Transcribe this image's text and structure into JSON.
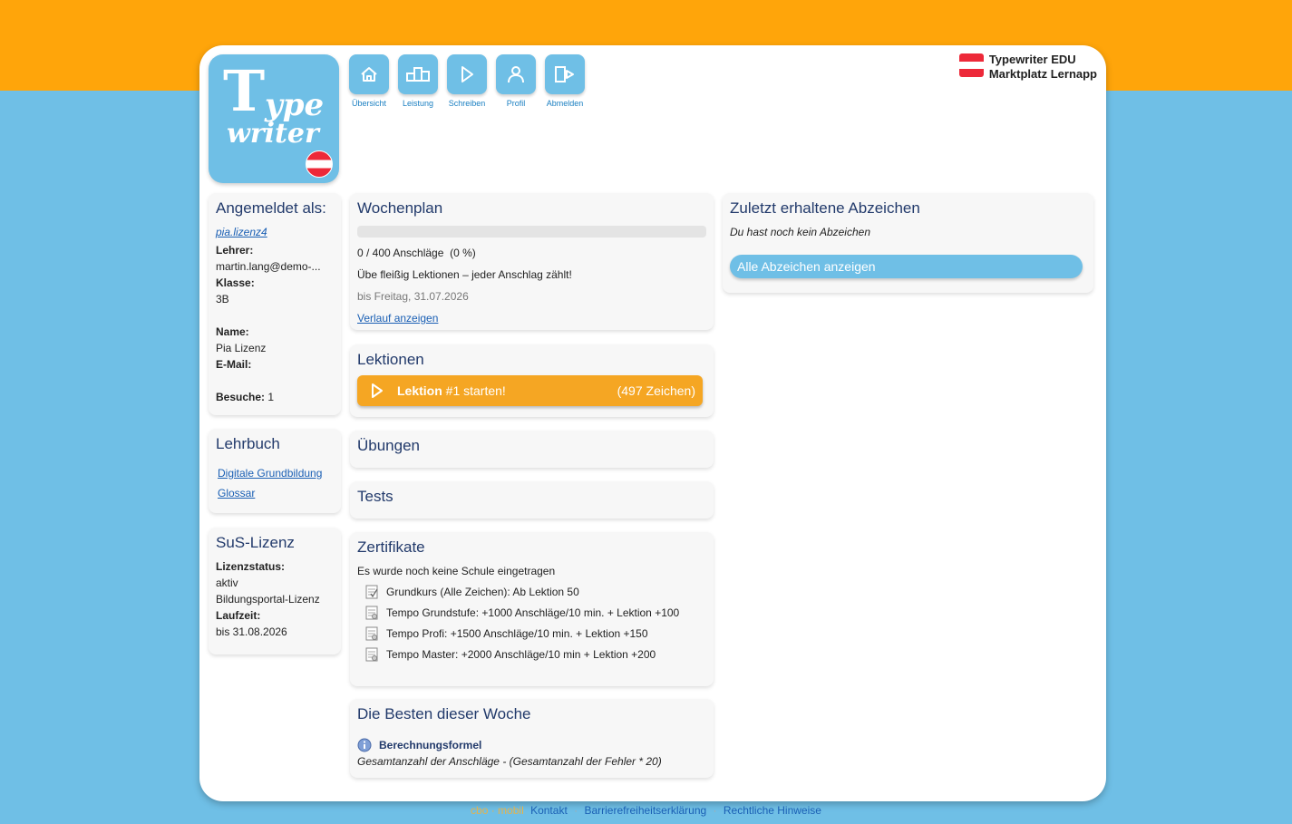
{
  "logo": {
    "word1": "T",
    "word1b": "ype",
    "word2": "writer"
  },
  "nav": [
    {
      "label": "Übersicht",
      "icon": "home-icon"
    },
    {
      "label": "Leistung",
      "icon": "podium-icon"
    },
    {
      "label": "Schreiben",
      "icon": "play-icon"
    },
    {
      "label": "Profil",
      "icon": "user-icon"
    },
    {
      "label": "Abmelden",
      "icon": "logout-icon"
    }
  ],
  "brand": {
    "line1": "Typewriter EDU",
    "line2": "Marktplatz Lernapp"
  },
  "account": {
    "title": "Angemeldet als:",
    "username": "pia.lizenz4",
    "teacher_label": "Lehrer:",
    "teacher": "martin.lang@demo-...",
    "class_label": "Klasse:",
    "class": "3B",
    "name_label": "Name:",
    "name": "Pia Lizenz",
    "email_label": "E-Mail:",
    "visits_label": "Besuche:",
    "visits": "1"
  },
  "textbook": {
    "title": "Lehrbuch",
    "links": [
      "Digitale Grundbildung",
      "Glossar"
    ]
  },
  "license": {
    "title": "SuS-Lizenz",
    "status_label": "Lizenzstatus:",
    "status": "aktiv",
    "type": "Bildungsportal-Lizenz",
    "runtime_label": "Laufzeit:",
    "runtime": "bis 31.08.2026"
  },
  "weekplan": {
    "title": "Wochenplan",
    "progress": 0,
    "progress_text": "0 / 400 Anschläge  (0 %)",
    "motto": "Übe fleißig Lektionen – jeder Anschlag zählt!",
    "deadline": "bis Freitag, 31.07.2026",
    "history_link": "Verlauf anzeigen"
  },
  "lessons": {
    "title": "Lektionen",
    "start_bold": "Lektion",
    "start_rest": " #1 starten!",
    "count": "(497 Zeichen)"
  },
  "exercises": {
    "title": "Übungen"
  },
  "tests": {
    "title": "Tests"
  },
  "certificates": {
    "title": "Zertifikate",
    "note": "Es wurde noch keine Schule eingetragen",
    "items": [
      "Grundkurs (Alle Zeichen): Ab Lektion 50",
      "Tempo Grundstufe: +1000 Anschläge/10 min. + Lektion +100",
      "Tempo Profi: +1500 Anschläge/10 min. + Lektion +150",
      "Tempo Master: +2000 Anschläge/10 min + Lektion +200"
    ]
  },
  "best": {
    "title": "Die Besten dieser Woche",
    "formula_label": "Berechnungsformel",
    "formula": "Gesamtanzahl der Anschläge - (Gesamtanzahl der Fehler * 20)"
  },
  "badges": {
    "title": "Zuletzt erhaltene Abzeichen",
    "empty": "Du hast noch kein Abzeichen",
    "button": "Alle Abzeichen anzeigen"
  },
  "footer": {
    "ghost": "cbo · mobil",
    "links": [
      "Kontakt",
      "Barrierefreiheitserklärung",
      "Rechtliche Hinweise"
    ]
  },
  "colors": {
    "orange": "#ffa50a",
    "sky": "#6fbfe6",
    "heading": "#223a6b",
    "link": "#1a5fb4",
    "lesson": "#f5a623"
  }
}
